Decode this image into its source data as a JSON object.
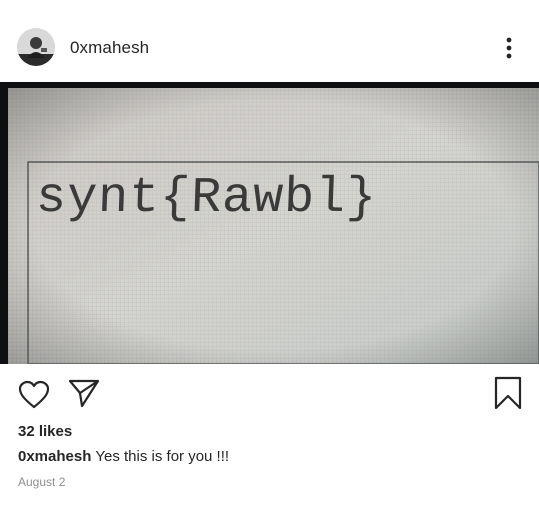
{
  "post": {
    "username": "0xmahesh",
    "more_icon": "more-vertical-icon",
    "image_text": "synt{Rawbl}",
    "likes": "32 likes",
    "caption_user": "0xmahesh",
    "caption_text": "Yes this is for you !!!",
    "date": "August 2"
  },
  "icons": {
    "like": "heart-icon",
    "share": "send-icon",
    "save": "bookmark-icon"
  }
}
